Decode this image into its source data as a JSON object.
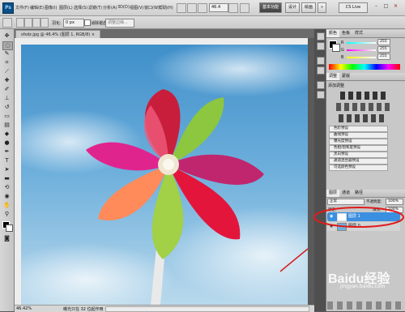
{
  "app": {
    "logo": "Ps",
    "menus": [
      "文件(F)",
      "编辑(E)",
      "图像(I)",
      "图层(L)",
      "选择(S)",
      "滤镜(T)",
      "分析(A)",
      "3D(D)",
      "视图(V)",
      "窗口(W)",
      "帮助(H)"
    ],
    "zoom_value": "46.4",
    "workspace_buttons": [
      "基本功能",
      "设计",
      "绘画",
      "»"
    ],
    "cs_live": "CS Live",
    "window_controls": [
      "–",
      "□",
      "×"
    ]
  },
  "options": {
    "feather_label": "羽化:",
    "feather_value": "0 px",
    "antialias_label": "消除锯齿",
    "refine_label": "调整边缘..."
  },
  "document": {
    "tab_label": "sfsdz.jpg @ 46.4% (图层 1, RGB/8) ×",
    "status_zoom": "46.42%",
    "status_info": "曝光只在 32 位起作用"
  },
  "color_panel": {
    "tabs": [
      "颜色",
      "色板",
      "样式"
    ],
    "sliders": [
      {
        "label": "R",
        "value": "255"
      },
      {
        "label": "G",
        "value": "255"
      },
      {
        "label": "B",
        "value": "255"
      }
    ]
  },
  "adjustments_panel": {
    "tabs": [
      "调整",
      "蒙版"
    ],
    "subtitle": "添加调整",
    "presets": [
      "色阶预设",
      "曲线预设",
      "曝光度预设",
      "色相/饱和度预设",
      "黑白预设",
      "通道混合器预设",
      "可选颜色预设"
    ]
  },
  "layers_panel": {
    "tabs": [
      "图层",
      "通道",
      "路径"
    ],
    "blend_mode": "正常",
    "opacity_label": "不透明度:",
    "opacity_value": "100%",
    "lock_label": "锁定:",
    "fill_label": "填充:",
    "fill_value": "100%",
    "layers": [
      {
        "name": "图层 1",
        "selected": true
      },
      {
        "name": "图层 0",
        "selected": false
      }
    ]
  },
  "watermark": {
    "brand": "Baidu经验",
    "url": "jingyan.baidu.com"
  }
}
